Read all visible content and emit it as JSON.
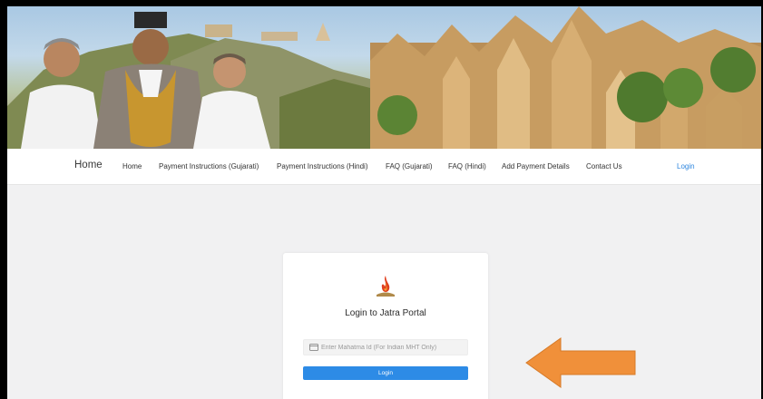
{
  "nav": {
    "brand": "Home",
    "items": [
      "Home",
      "Payment Instructions (Gujarati)",
      "Payment Instructions (Hindi)",
      "FAQ (Gujarati)",
      "FAQ (Hindi)",
      "Add Payment Details",
      "Contact Us"
    ],
    "login": "Login"
  },
  "login_card": {
    "title": "Login to Jatra Portal",
    "input_placeholder": "Enter Mahatma Id (For Indian MHT Only)",
    "button_label": "Login"
  },
  "colors": {
    "accent": "#2d8be6",
    "nav_login": "#2e86de",
    "arrow_fill": "#f0903a",
    "background": "#f1f1f2"
  },
  "icons": {
    "input": "id-card-icon",
    "logo": "flame-logo-icon",
    "annotation": "orange-left-arrow"
  }
}
